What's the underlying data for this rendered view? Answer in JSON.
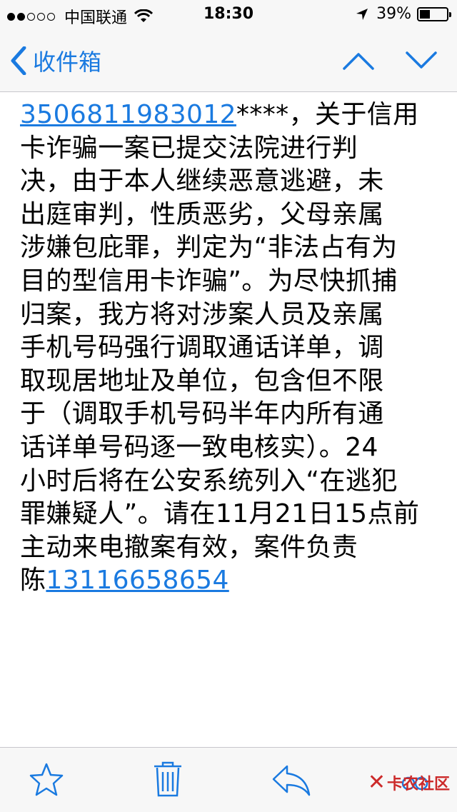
{
  "status_bar": {
    "carrier": "中国联通",
    "time": "18:30",
    "battery": "39%",
    "battery_level": 0.39,
    "signal_strength": 2,
    "signal_max": 5
  },
  "nav": {
    "back_label": "收件箱"
  },
  "message": {
    "lines": [
      {
        "link": "3506811983012",
        "text": "****，关于信用"
      },
      {
        "text": "卡诈骗一案已提交法院进行判"
      },
      {
        "text": "决，由于本人继续恶意逃避，未"
      },
      {
        "text": "出庭审判，性质恶劣，父母亲属"
      },
      {
        "text": "涉嫌包庇罪，判定为“非法占有为"
      },
      {
        "text": "目的型信用卡诈骗”。为尽快抓捕"
      },
      {
        "text": "归案，我方将对涉案人员及亲属"
      },
      {
        "text": "手机号码强行调取通话详单，调"
      },
      {
        "text": "取现居地址及单位，包含但不限"
      },
      {
        "text": "于（调取手机号码半年内所有通"
      },
      {
        "text": "话详单号码逐一致电核实）。24"
      },
      {
        "text": "小时后将在公安系统列入“在逃犯"
      },
      {
        "text": "罪嫌疑人”。请在11月21日15点前"
      },
      {
        "text": "主动来电撤案有效，案件负责"
      },
      {
        "text": "陈",
        "link_after": "13116658654"
      }
    ]
  },
  "watermark": "卡农社区",
  "colors": {
    "accent": "#1a7ae0",
    "bar_bg": "#f7f7f7",
    "watermark": "#cc2a2a"
  },
  "icons": {
    "back": "chevron-left-icon",
    "prev": "chevron-up-icon",
    "next": "chevron-down-icon",
    "flag": "star-icon",
    "trash": "trash-icon",
    "reply": "reply-icon"
  }
}
